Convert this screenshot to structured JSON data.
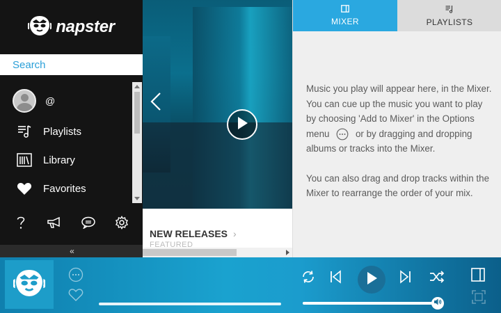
{
  "brand": {
    "name": "napster"
  },
  "search": {
    "placeholder": "Search"
  },
  "user": {
    "name": "@"
  },
  "nav": {
    "items": [
      {
        "label": "Playlists",
        "icon": "playlist-icon"
      },
      {
        "label": "Library",
        "icon": "library-icon"
      },
      {
        "label": "Favorites",
        "icon": "heart-icon"
      }
    ]
  },
  "utility_icons": [
    "help-icon",
    "announcement-icon",
    "chat-icon",
    "settings-icon"
  ],
  "collapse": {
    "label": "«"
  },
  "featured": {
    "section_title": "NEW RELEASES",
    "section_chevron": "›",
    "section_subtitle": "FEATURED"
  },
  "tabs": [
    {
      "label": "MIXER",
      "icon": "mixer-icon",
      "active": true
    },
    {
      "label": "PLAYLISTS",
      "icon": "playlist-icon",
      "active": false
    }
  ],
  "mixer": {
    "text_before_icon": "Music you play will appear here, in the Mixer. You can cue up the music you want to play by choosing 'Add to Mixer' in the Options menu",
    "text_after_icon": "or by dragging and dropping albums or tracks into the Mixer.",
    "paragraph_2": "You can also drag and drop tracks within the Mixer to rearrange the order of your mix."
  },
  "player": {
    "volume_level": 0.97,
    "progress_level": 0
  },
  "colors": {
    "accent": "#2aa8e0",
    "sidebar_bg": "#141414",
    "right_panel_bg": "#efefef",
    "player_bg": "#1aa2cf"
  }
}
